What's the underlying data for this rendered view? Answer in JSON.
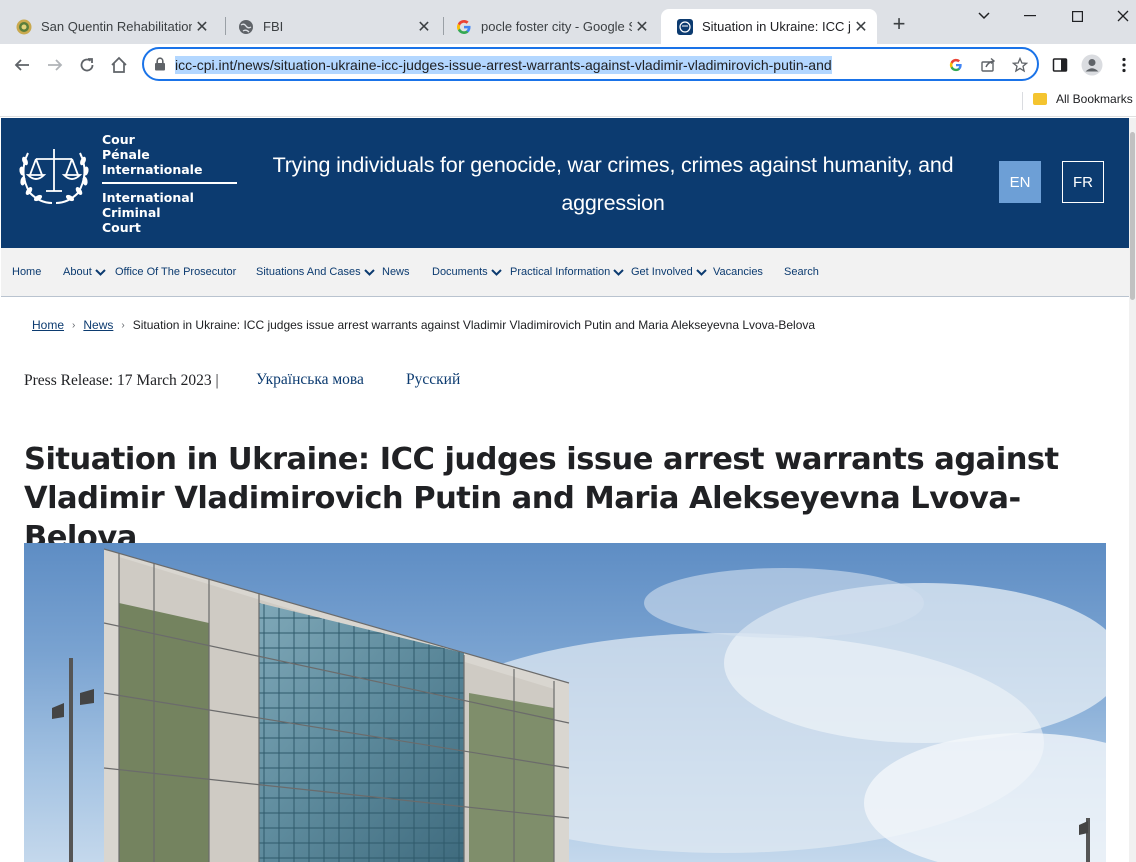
{
  "browser": {
    "tabs": [
      {
        "title": "San Quentin Rehabilitation C",
        "active": false
      },
      {
        "title": "FBI",
        "active": false
      },
      {
        "title": "pocle foster city - Google Se",
        "active": false
      },
      {
        "title": "Situation in Ukraine: ICC jud",
        "active": true
      }
    ],
    "url": "icc-cpi.int/news/situation-ukraine-icc-judges-issue-arrest-warrants-against-vladimir-vladimirovich-putin-and",
    "bookmarks_label": "All Bookmarks"
  },
  "site": {
    "logo_fr": [
      "Cour",
      "Pénale",
      "Internationale"
    ],
    "logo_en": [
      "International",
      "Criminal",
      "Court"
    ],
    "tagline": "Trying individuals for genocide, war crimes, crimes against humanity, and aggression",
    "lang_en": "EN",
    "lang_fr": "FR",
    "nav": [
      {
        "label": "Home",
        "dropdown": false
      },
      {
        "label": "About",
        "dropdown": true
      },
      {
        "label": "Office Of The Prosecutor",
        "dropdown": false
      },
      {
        "label": "Situations And Cases",
        "dropdown": true
      },
      {
        "label": "News",
        "dropdown": false
      },
      {
        "label": "Documents",
        "dropdown": true
      },
      {
        "label": "Practical Information",
        "dropdown": true
      },
      {
        "label": "Get Involved",
        "dropdown": true
      },
      {
        "label": "Vacancies",
        "dropdown": false
      },
      {
        "label": "Search",
        "dropdown": false
      }
    ]
  },
  "article": {
    "breadcrumb": {
      "home": "Home",
      "news": "News",
      "current": "Situation in Ukraine: ICC judges issue arrest warrants against Vladimir Vladimirovich Putin and Maria Alekseyevna Lvova-Belova"
    },
    "press_release": "Press Release: 17 March 2023 |",
    "lang_links": [
      "Українська мова",
      "Русский"
    ],
    "headline": "Situation in Ukraine: ICC judges issue arrest warrants against Vladimir Vladimirovich Putin and Maria Alekseyevna Lvova-Belova"
  },
  "colors": {
    "header_blue": "#0c3b70",
    "lang_active": "#6d9fd6",
    "nav_bg": "#f2f2f2",
    "omnibox_focus": "#1a73e8"
  }
}
